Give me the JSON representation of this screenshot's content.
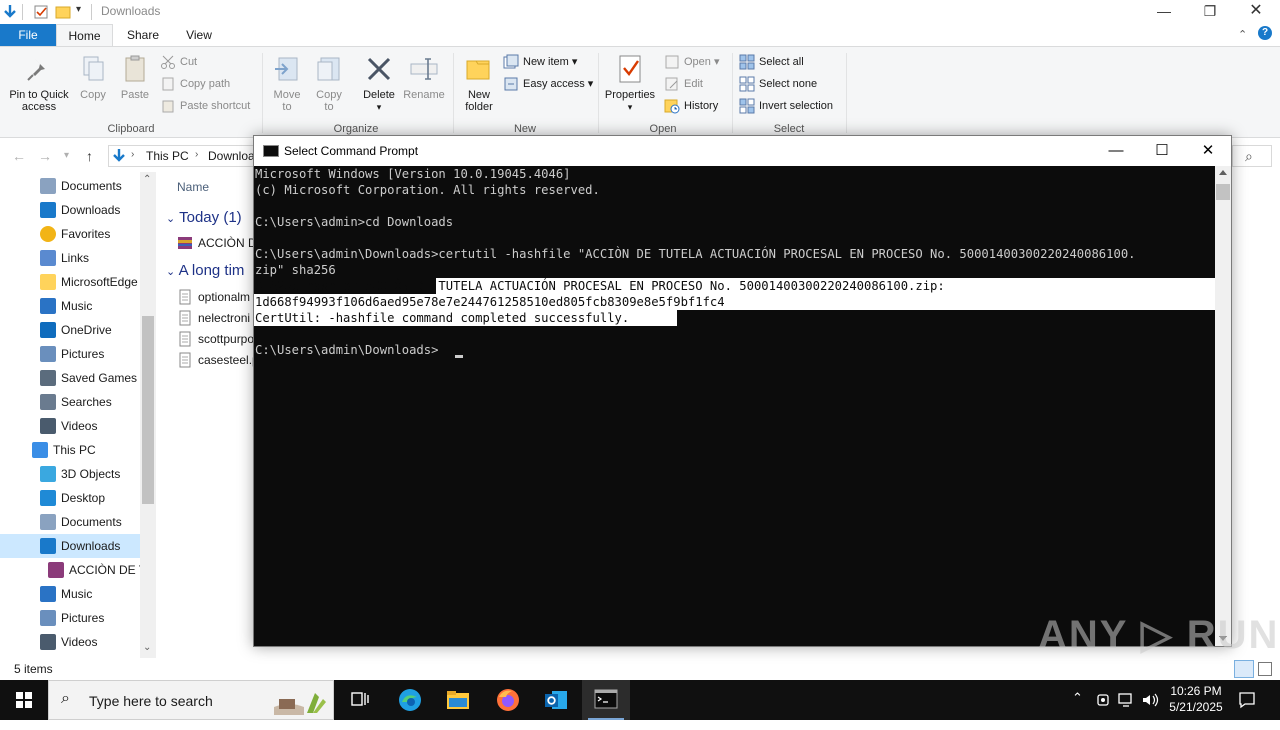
{
  "explorer": {
    "window_title": "Downloads",
    "tabs": [
      "File",
      "Home",
      "Share",
      "View"
    ],
    "ribbon": {
      "clipboard": {
        "label": "Clipboard",
        "pin": "Pin to Quick\naccess",
        "copy": "Copy",
        "paste": "Paste",
        "cut": "Cut",
        "copy_path": "Copy path",
        "paste_shortcut": "Paste shortcut"
      },
      "organize": {
        "label": "Organize",
        "move_to": "Move\nto",
        "copy_to": "Copy\nto",
        "delete": "Delete",
        "rename": "Rename"
      },
      "new": {
        "label": "New",
        "new_folder": "New\nfolder",
        "new_item": "New item",
        "easy_access": "Easy access"
      },
      "open": {
        "label": "Open",
        "properties": "Properties",
        "open": "Open",
        "edit": "Edit",
        "history": "History"
      },
      "select": {
        "label": "Select",
        "select_all": "Select all",
        "select_none": "Select none",
        "invert_selection": "Invert selection"
      }
    },
    "address": {
      "this_pc": "This PC",
      "downloads": "Downloa"
    },
    "nav_items": [
      {
        "label": "Documents",
        "icon": "documents-icon"
      },
      {
        "label": "Downloads",
        "icon": "downloads-icon"
      },
      {
        "label": "Favorites",
        "icon": "favorites-icon"
      },
      {
        "label": "Links",
        "icon": "links-icon"
      },
      {
        "label": "MicrosoftEdge",
        "icon": "folder-icon"
      },
      {
        "label": "Music",
        "icon": "music-icon"
      },
      {
        "label": "OneDrive",
        "icon": "onedrive-icon"
      },
      {
        "label": "Pictures",
        "icon": "pictures-icon"
      },
      {
        "label": "Saved Games",
        "icon": "saved-games-icon"
      },
      {
        "label": "Searches",
        "icon": "searches-icon"
      },
      {
        "label": "Videos",
        "icon": "videos-icon"
      },
      {
        "label": "This PC",
        "icon": "this-pc-icon"
      },
      {
        "label": "3D Objects",
        "icon": "3d-objects-icon"
      },
      {
        "label": "Desktop",
        "icon": "desktop-icon"
      },
      {
        "label": "Documents",
        "icon": "documents-icon"
      },
      {
        "label": "Downloads",
        "icon": "downloads-icon"
      },
      {
        "label": "ACCIÒN DE T",
        "icon": "archive-icon"
      },
      {
        "label": "Music",
        "icon": "music-icon"
      },
      {
        "label": "Pictures",
        "icon": "pictures-icon"
      },
      {
        "label": "Videos",
        "icon": "videos-icon"
      }
    ],
    "list": {
      "column_name": "Name",
      "group_today": "Today (1)",
      "group_long_ago": "A long tim",
      "files": [
        "ACCIÒN D",
        "optionalm",
        "nelectroni",
        "scottpurpo",
        "casesteel.p"
      ]
    },
    "status": "5 items"
  },
  "cmd": {
    "title": "Select Command Prompt",
    "lines": [
      "Microsoft Windows [Version 10.0.19045.4046]",
      "(c) Microsoft Corporation. All rights reserved.",
      "",
      "C:\\Users\\admin>cd Downloads",
      "",
      "C:\\Users\\admin\\Downloads>certutil -hashfile \"ACCIÒN DE TUTELA ACTUACIÓN PROCESAL EN PROCESO No. 50001400300220240086100.",
      "zip\" sha256",
      "SHA256 hash of ACCIÒN DE TUTELA ACTUACIÓN PROCESAL EN PROCESO No. 50001400300220240086100.zip:",
      "1d668f94993f106d6aed95e78e7e244761258510ed805fcb8309e8e5f9bf1fc4",
      "CertUtil: -hashfile command completed successfully.",
      "",
      "C:\\Users\\admin\\Downloads>"
    ]
  },
  "watermark": "ANY RUN",
  "taskbar": {
    "search_placeholder": "Type here to search",
    "time": "10:26 PM",
    "date": "5/21/2025"
  },
  "colors": {
    "accent": "#1979ca",
    "console_bg": "#0c0c0c",
    "console_fg": "#cccccc",
    "selection": "#cce8ff",
    "taskbar": "#101010"
  }
}
